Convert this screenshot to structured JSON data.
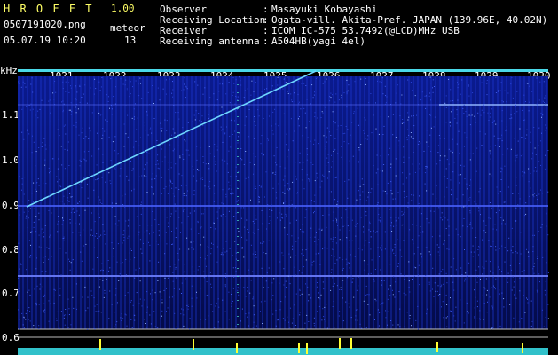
{
  "header": {
    "app_name": "H R O F F T",
    "version": "1.00",
    "filename": "0507191020.png",
    "datetime": "05.07.19 10:20",
    "meteor_label": "meteor",
    "meteor_count": "13"
  },
  "info": [
    {
      "key": "Observer",
      "sep": ":",
      "value": "Masayuki Kobayashi"
    },
    {
      "key": "Receiving Location",
      "sep": ":",
      "value": "Ogata-vill. Akita-Pref. JAPAN (139.96E, 40.02N)"
    },
    {
      "key": "Receiver",
      "sep": ":",
      "value": "ICOM IC-575 53.7492(@LCD)MHz USB"
    },
    {
      "key": "Receiving antenna",
      "sep": ":",
      "value": "A504HB(yagi 4el)"
    }
  ],
  "freq_axis": {
    "unit": "kHz",
    "labels": [
      "1021",
      "1022",
      "1023",
      "1024",
      "1025",
      "1026",
      "1027",
      "1028",
      "1029",
      "1030"
    ]
  },
  "y_axis": {
    "labels": [
      "1.1",
      "1.0",
      "0.9",
      "0.8",
      "0.7",
      "0.6"
    ]
  },
  "colors": {
    "background": "#000000",
    "noise": "#1a2fc8",
    "trace": "#6fd7ff",
    "level_bars": "#ffff33",
    "level_floor": "#36d6e0"
  }
}
